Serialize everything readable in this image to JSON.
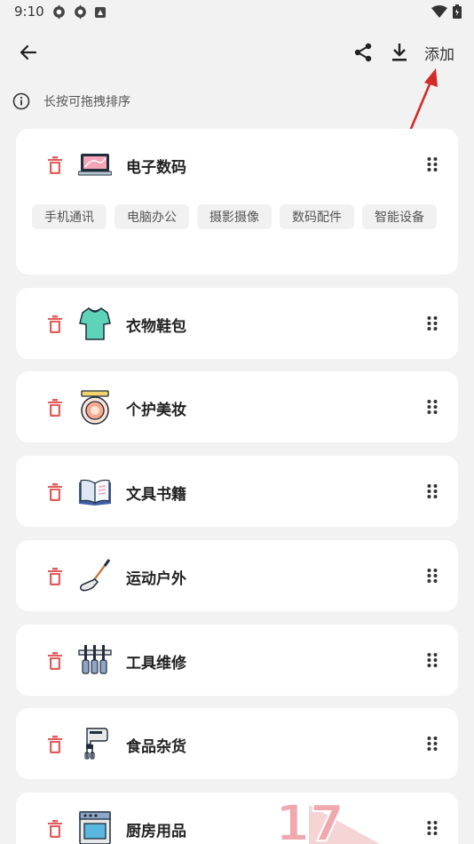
{
  "status_bar": {
    "time": "9:10",
    "left_icons": [
      "settings-gear-icon",
      "settings-gear-icon",
      "app-notification-icon"
    ],
    "right_icons": [
      "wifi-icon",
      "battery-icon"
    ]
  },
  "app_bar": {
    "back_icon": "arrow-left-icon",
    "share_icon": "share-icon",
    "download_icon": "download-icon",
    "add_label": "添加"
  },
  "hint": {
    "icon": "info-icon",
    "text": "长按可拖拽排序"
  },
  "categories": [
    {
      "name": "电子数码",
      "icon": "laptop-icon",
      "subcategories": [
        "手机通讯",
        "电脑办公",
        "摄影摄像",
        "数码配件",
        "智能设备"
      ]
    },
    {
      "name": "衣物鞋包",
      "icon": "tshirt-icon"
    },
    {
      "name": "个护美妆",
      "icon": "compact-mirror-icon"
    },
    {
      "name": "文具书籍",
      "icon": "open-book-icon"
    },
    {
      "name": "运动户外",
      "icon": "golf-club-icon"
    },
    {
      "name": "工具维修",
      "icon": "tool-rack-icon"
    },
    {
      "name": "食品杂货",
      "icon": "hand-mixer-icon"
    },
    {
      "name": "厨房用品",
      "icon": "oven-icon"
    }
  ],
  "colors": {
    "delete": "#e25b5b",
    "annotation_arrow": "#d42a2a",
    "background": "#f2f2f2",
    "card": "#ffffff",
    "chip": "#f1f1f1"
  },
  "watermark": {
    "text": "17"
  }
}
